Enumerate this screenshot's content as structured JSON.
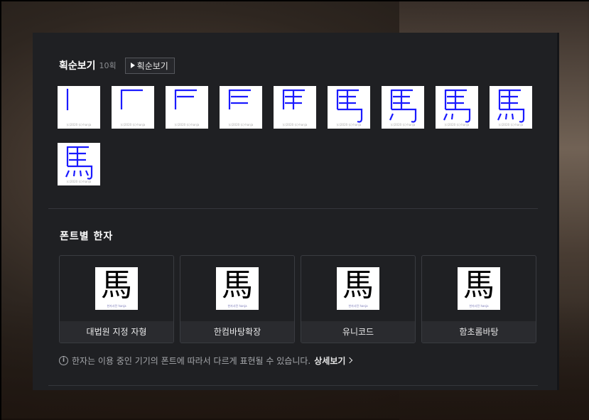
{
  "stroke_order": {
    "title": "획순보기",
    "count": "10획",
    "play_label": "획순보기",
    "watermark": "(c)2020 (c)-hanja",
    "steps": [
      1,
      2,
      3,
      4,
      5,
      6,
      7,
      8,
      9,
      10
    ],
    "stroke_color": "#1a1aff"
  },
  "fonts": {
    "title": "폰트별 한자",
    "character": "馬",
    "watermark": "한자사전 hanja",
    "cards": [
      {
        "label": "대법원 지정 자형"
      },
      {
        "label": "한컴바탕확장"
      },
      {
        "label": "유니코드"
      },
      {
        "label": "함초롬바탕"
      }
    ]
  },
  "notice": {
    "text": "한자는 이용 중인 기기의 폰트에 따라서 다르게 표현될 수 있습니다.",
    "link_label": "상세보기"
  }
}
